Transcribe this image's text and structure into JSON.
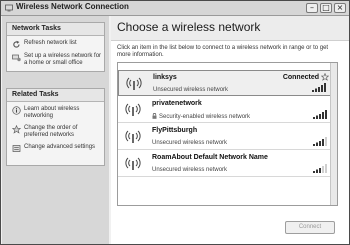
{
  "window": {
    "title": "Wireless Network Connection",
    "minimize_glyph": "–",
    "maximize_glyph": "□",
    "close_glyph": "×"
  },
  "network_tasks": {
    "heading": "Network Tasks",
    "items": [
      {
        "label": "Refresh network list",
        "icon": "refresh-icon"
      },
      {
        "label": "Set up a wireless network for a home or small office",
        "icon": "setup-network-icon"
      }
    ]
  },
  "related_tasks": {
    "heading": "Related Tasks",
    "items": [
      {
        "label": "Learn about wireless networking",
        "icon": "info-icon"
      },
      {
        "label": "Change the order of preferred networks",
        "icon": "star-icon"
      },
      {
        "label": "Change advanced settings",
        "icon": "settings-icon"
      }
    ]
  },
  "main": {
    "title": "Choose a wireless network",
    "instructions": "Click an item in the list below to connect to a wireless network in range or to get more information.",
    "networks": [
      {
        "name": "linksys",
        "description": "Unsecured wireless network",
        "status": "Connected",
        "secured": false,
        "preferred": true,
        "signal_bars": 5
      },
      {
        "name": "privatenetwork",
        "description": "Security-enabled wireless network",
        "status": "",
        "secured": true,
        "preferred": false,
        "signal_bars": 5
      },
      {
        "name": "FlyPittsburgh",
        "description": "Unsecured wireless network",
        "status": "",
        "secured": false,
        "preferred": false,
        "signal_bars": 4
      },
      {
        "name": "RoamAbout Default Network Name",
        "description": "Unsecured wireless network",
        "status": "",
        "secured": false,
        "preferred": false,
        "signal_bars": 3
      }
    ],
    "connect_label": "Connect"
  }
}
